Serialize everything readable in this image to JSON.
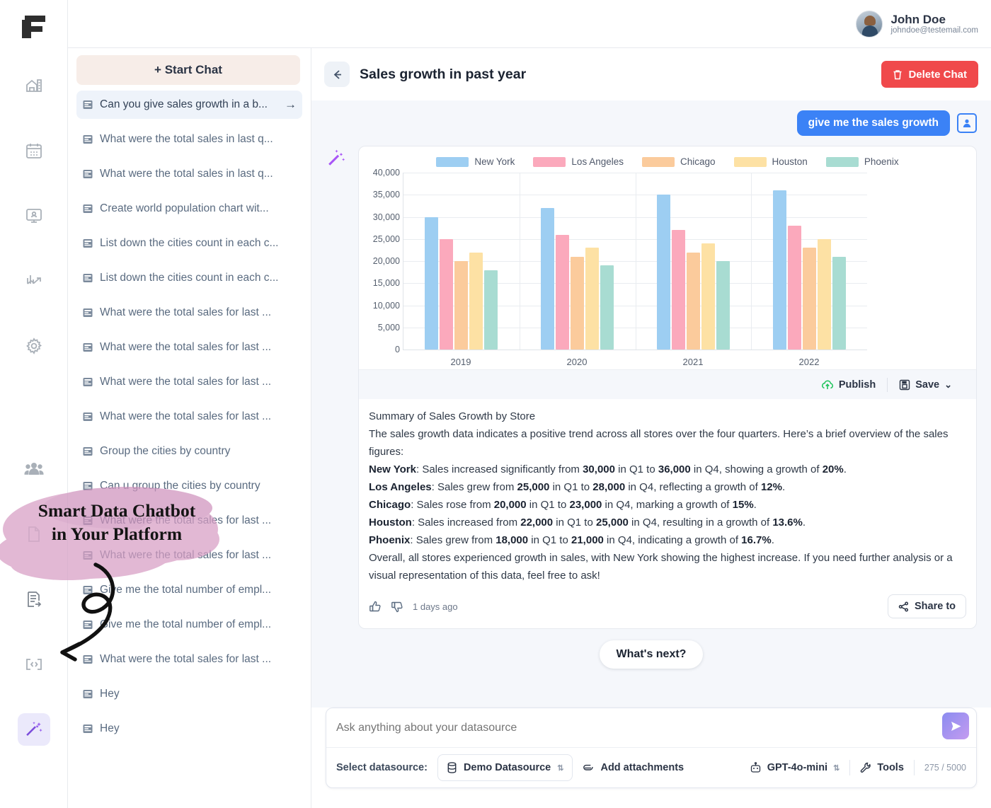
{
  "brand": {
    "logo_icon": "layered-f-logo"
  },
  "topbar": {
    "user_name": "John Doe",
    "user_email": "johndoe@testemail.com",
    "avatar_icon": "user-avatar"
  },
  "rail": {
    "items": [
      {
        "icon": "warehouse-icon",
        "active": false
      },
      {
        "icon": "calendar-icon",
        "active": false
      },
      {
        "icon": "monitor-user-icon",
        "active": false
      },
      {
        "icon": "chart-trend-icon",
        "active": false
      },
      {
        "icon": "gear-icon",
        "active": false
      }
    ],
    "items_bottom": [
      {
        "icon": "users-icon",
        "active": false
      },
      {
        "icon": "document-icon",
        "active": false
      },
      {
        "icon": "file-export-icon",
        "active": false
      },
      {
        "icon": "code-brackets-icon",
        "active": false
      },
      {
        "icon": "magic-wand-icon",
        "active": true
      }
    ]
  },
  "sidebar": {
    "start_chat_label": "+ Start Chat",
    "item_icon": "chat-document-icon",
    "items": [
      {
        "label": "Can you give sales growth in a b...",
        "selected": true,
        "arrow": "→"
      },
      {
        "label": "What were the total sales in last q...",
        "selected": false
      },
      {
        "label": "What were the total sales in last q...",
        "selected": false
      },
      {
        "label": "Create world population chart wit...",
        "selected": false
      },
      {
        "label": "List down the cities count in each c...",
        "selected": false
      },
      {
        "label": "List down the cities count in each c...",
        "selected": false
      },
      {
        "label": "What were the total sales for last ...",
        "selected": false
      },
      {
        "label": "What were the total sales for last ...",
        "selected": false
      },
      {
        "label": "What were the total sales for last ...",
        "selected": false
      },
      {
        "label": "What were the total sales for last ...",
        "selected": false
      },
      {
        "label": "Group the cities by country",
        "selected": false
      },
      {
        "label": "Can u group the cities by country",
        "selected": false
      },
      {
        "label": "What were the total sales for last ...",
        "selected": false
      },
      {
        "label": "What were the total sales for last ...",
        "selected": false
      },
      {
        "label": "Give me the total number of empl...",
        "selected": false
      },
      {
        "label": "Give me the total number of empl...",
        "selected": false
      },
      {
        "label": "What were the total sales for last ...",
        "selected": false
      },
      {
        "label": "Hey",
        "selected": false
      },
      {
        "label": "Hey",
        "selected": false
      }
    ]
  },
  "conversation": {
    "back_icon": "arrow-left-icon",
    "title": "Sales growth in past year",
    "delete_label": "Delete Chat",
    "delete_icon": "trash-icon",
    "delete_color": "#f0494b"
  },
  "message": {
    "user_text": "give me the sales growth",
    "user_icon": "user-badge-icon",
    "assistant_icon": "magic-wand-icon",
    "card_actions": [
      {
        "label": "Publish",
        "icon": "cloud-upload-icon"
      },
      {
        "label": "Save",
        "icon": "save-disk-icon",
        "caret": "⌄"
      }
    ],
    "answer": {
      "heading": "Summary of Sales Growth by Store",
      "intro": "The sales growth data indicates a positive trend across all stores over the four quarters. Here’s a brief overview of the sales figures:",
      "lines": [
        {
          "store": "New York",
          "text_a": ": Sales increased significantly from ",
          "v1": "30,000",
          "text_b": " in Q1 to ",
          "v2": "36,000",
          "text_c": " in Q4, showing a growth of ",
          "pct": "20%",
          "text_d": "."
        },
        {
          "store": "Los Angeles",
          "text_a": ": Sales grew from ",
          "v1": "25,000",
          "text_b": " in Q1 to ",
          "v2": "28,000",
          "text_c": " in Q4, reflecting a growth of ",
          "pct": "12%",
          "text_d": "."
        },
        {
          "store": "Chicago",
          "text_a": ": Sales rose from ",
          "v1": "20,000",
          "text_b": " in Q1 to ",
          "v2": "23,000",
          "text_c": " in Q4, marking a growth of ",
          "pct": "15%",
          "text_d": "."
        },
        {
          "store": "Houston",
          "text_a": ": Sales increased from ",
          "v1": "22,000",
          "text_b": " in Q1 to ",
          "v2": "25,000",
          "text_c": " in Q4, resulting in a growth of ",
          "pct": "13.6%",
          "text_d": "."
        },
        {
          "store": "Phoenix",
          "text_a": ": Sales grew from ",
          "v1": "18,000",
          "text_b": " in Q1 to ",
          "v2": "21,000",
          "text_c": " in Q4, indicating a growth of ",
          "pct": "16.7%",
          "text_d": "."
        }
      ],
      "outro": "Overall, all stores experienced growth in sales, with New York showing the highest increase. If you need further analysis or a visual representation of this data, feel free to ask!"
    },
    "footer": {
      "like_icon": "thumbs-up-icon",
      "dislike_icon": "thumbs-down-icon",
      "timestamp": "1 days ago",
      "share_label": "Share to",
      "share_icon": "share-icon"
    }
  },
  "whats_next_label": "What's next?",
  "composer": {
    "placeholder": "Ask anything about your datasource",
    "value": "",
    "send_icon": "send-icon",
    "datasource_label": "Select datasource:",
    "datasource_value": "Demo Datasource",
    "datasource_icon": "database-icon",
    "attach_label": "Add attachments",
    "attach_icon": "paperclip-icon",
    "model_value": "GPT-4o-mini",
    "model_icon": "robot-icon",
    "tools_label": "Tools",
    "tools_icon": "wrench-icon",
    "char_count": "275 / 5000"
  },
  "annotation": {
    "line1": "Smart Data Chatbot",
    "line2": "in Your Platform",
    "highlight_color": "#d79ec4",
    "arrow_icon": "curved-arrow-icon"
  },
  "chart_data": {
    "type": "bar",
    "title": "",
    "xlabel": "",
    "ylabel": "",
    "categories": [
      "2019",
      "2020",
      "2021",
      "2022"
    ],
    "ylim": [
      0,
      40000
    ],
    "yticks": [
      "0",
      "5,000",
      "10,000",
      "15,000",
      "20,000",
      "25,000",
      "30,000",
      "35,000",
      "40,000"
    ],
    "grid": true,
    "legend_position": "top",
    "series": [
      {
        "name": "New York",
        "color": "#9DCEF2",
        "values": [
          30000,
          32000,
          35000,
          36000
        ]
      },
      {
        "name": "Los Angeles",
        "color": "#FBA9BC",
        "values": [
          25000,
          26000,
          27000,
          28000
        ]
      },
      {
        "name": "Chicago",
        "color": "#FBCB9C",
        "values": [
          20000,
          21000,
          22000,
          23000
        ]
      },
      {
        "name": "Houston",
        "color": "#FDE1A4",
        "values": [
          22000,
          23000,
          24000,
          25000
        ]
      },
      {
        "name": "Phoenix",
        "color": "#A8DCD2",
        "values": [
          18000,
          19000,
          20000,
          21000
        ]
      }
    ]
  }
}
